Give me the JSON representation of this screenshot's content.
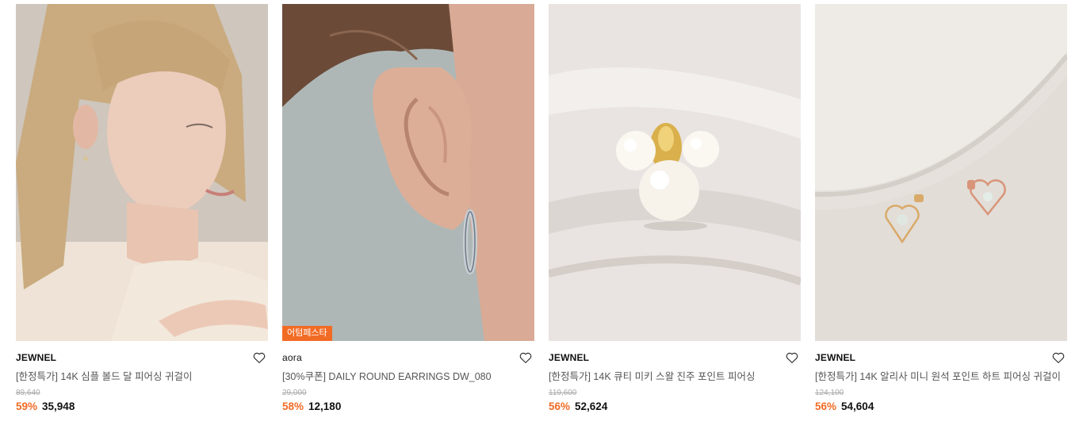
{
  "products": [
    {
      "brand": "JEWNEL",
      "name": "[한정특가] 14K 심플 볼드 달 피어싱 귀걸이",
      "original_price": "89,640",
      "discount": "59%",
      "price": "35,948",
      "badge": "",
      "extra": "",
      "colors": {
        "bg": "#cfc6bd",
        "skin": "#e7c6b3",
        "hair": "#c6a679"
      }
    },
    {
      "brand": "aora",
      "name": "[30%쿠폰] DAILY ROUND EARRINGS DW_080",
      "original_price": "29,000",
      "discount": "58%",
      "price": "12,180",
      "badge": "어텀페스타",
      "extra": "",
      "colors": {
        "bg": "#aeb7b6",
        "skin": "#dcae98",
        "hair": "#6b4a38"
      }
    },
    {
      "brand": "JEWNEL",
      "name": "[한정특가] 14K 큐티 미키 스왈 진주 포인트 피어싱",
      "original_price": "119,600",
      "discount": "56%",
      "price": "52,624",
      "badge": "",
      "extra": "",
      "colors": {
        "bg": "#e9e4e1",
        "pearl": "#fbf8f2",
        "gold": "#d9b04c"
      }
    },
    {
      "brand": "JEWNEL",
      "name": "[한정특가] 14K 알리사 미니 원석 포인트 하트 피어싱 귀걸이",
      "original_price": "124,100",
      "discount": "56%",
      "price": "54,604",
      "badge": "",
      "extra": "",
      "colors": {
        "bg": "#e6e1dc",
        "gold": "#d9aa6a",
        "rose": "#d9957a"
      }
    }
  ],
  "accent_color": "#f26b25"
}
